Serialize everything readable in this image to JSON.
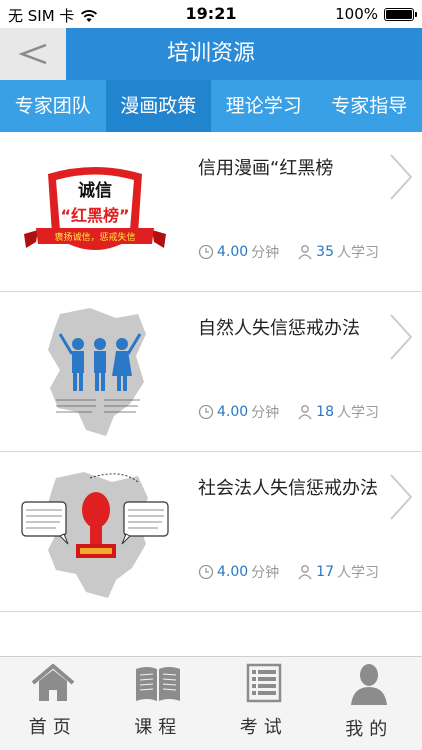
{
  "status_bar": {
    "carrier": "无 SIM 卡",
    "time": "19:21",
    "battery": "100%"
  },
  "nav": {
    "title": "培训资源",
    "back_icon": "back-chevron-icon"
  },
  "tabs": [
    {
      "label": "专家团队",
      "active": false
    },
    {
      "label": "漫画政策",
      "active": true
    },
    {
      "label": "理论学习",
      "active": false
    },
    {
      "label": "专家指导",
      "active": false
    }
  ],
  "courses": [
    {
      "title": "信用漫画“红黑榜",
      "duration": "4.00",
      "duration_unit": "分钟",
      "learners": "35",
      "learners_unit": "人学习",
      "thumb": {
        "shield_line1": "诚信",
        "shield_line2": "“红黑榜”",
        "ribbon": "褒扬诚信，惩戒失信"
      }
    },
    {
      "title": "自然人失信惩戒办法",
      "duration": "4.00",
      "duration_unit": "分钟",
      "learners": "18",
      "learners_unit": "人学习"
    },
    {
      "title": "社会法人失信惩戒办法",
      "duration": "4.00",
      "duration_unit": "分钟",
      "learners": "17",
      "learners_unit": "人学习"
    }
  ],
  "tabbar": [
    {
      "label": "首页",
      "icon": "home-icon"
    },
    {
      "label": "课程",
      "icon": "book-icon"
    },
    {
      "label": "考试",
      "icon": "exam-list-icon"
    },
    {
      "label": "我的",
      "icon": "person-icon"
    }
  ],
  "colors": {
    "nav_blue": "#2a8bd8",
    "tab_blue": "#3aa0e6",
    "tab_active": "#2184cf",
    "accent_num": "#2a78c2",
    "shield_red": "#e02020"
  }
}
